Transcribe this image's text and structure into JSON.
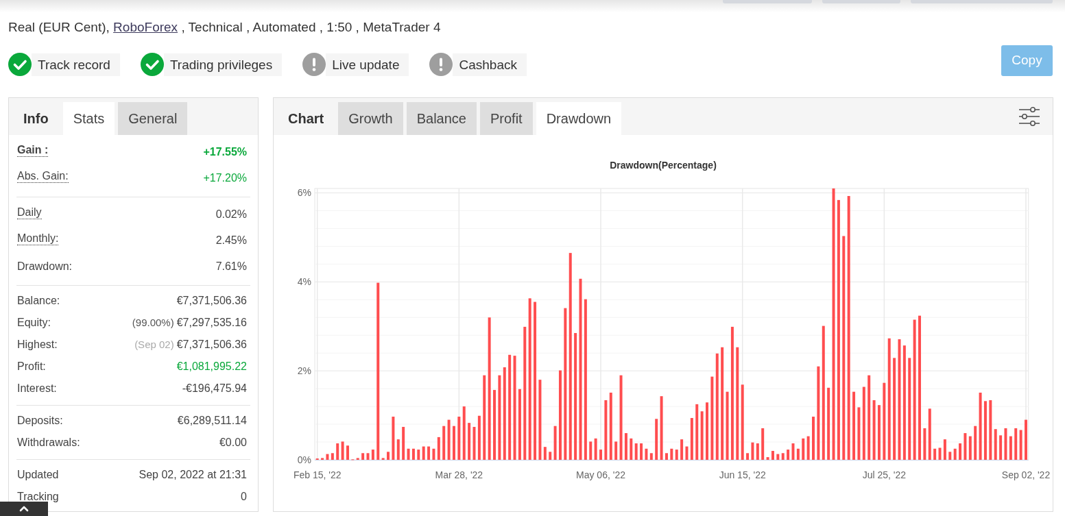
{
  "summary": [
    {
      "kind": "text",
      "text": "Real (EUR Cent),"
    },
    {
      "kind": "link",
      "text": "RoboForex"
    },
    {
      "kind": "text",
      "text": ", Technical , Automated , 1:50 , MetaTrader 4"
    }
  ],
  "badges": [
    {
      "label": "Track record",
      "verified": true
    },
    {
      "label": "Trading privileges",
      "verified": true
    },
    {
      "label": "Live update",
      "verified": false
    },
    {
      "label": "Cashback",
      "verified": false
    }
  ],
  "copy_button": {
    "label": "Copy"
  },
  "stats_panel": {
    "title": "Info",
    "tabs": [
      {
        "label": "Stats",
        "selected": true
      },
      {
        "label": "General",
        "selected": false
      }
    ],
    "groups": [
      {
        "rows": [
          {
            "label": "Gain :",
            "value": "+17.55%",
            "bold": true,
            "hint": true,
            "positive": true
          },
          {
            "label": "Abs. Gain:",
            "value": "+17.20%",
            "bold": false,
            "hint": true,
            "positive": true
          }
        ]
      },
      {
        "rows": [
          {
            "label": "Daily",
            "value": "0.02%",
            "bold": false,
            "hint": true,
            "positive": false
          },
          {
            "label": "Monthly:",
            "value": "2.45%",
            "bold": false,
            "hint": true,
            "positive": false
          },
          {
            "label": "Drawdown:",
            "value": "7.61%",
            "bold": false,
            "hint": false,
            "positive": false
          }
        ]
      },
      {
        "rows": [
          {
            "label": "Balance:",
            "value": "€7,371,506.36",
            "bold": false,
            "hint": false,
            "positive": false
          },
          {
            "label": "Equity:",
            "note": "(99.00%)",
            "note_muted": false,
            "value": "€7,297,535.16",
            "bold": false,
            "hint": false,
            "positive": false
          },
          {
            "label": "Highest:",
            "note": "(Sep 02)",
            "note_muted": true,
            "value": "€7,371,506.36",
            "bold": false,
            "hint": false,
            "positive": false
          },
          {
            "label": "Profit:",
            "value": "€1,081,995.22",
            "bold": false,
            "hint": false,
            "positive": true
          },
          {
            "label": "Interest:",
            "value": "-€196,475.94",
            "bold": false,
            "hint": false,
            "positive": false
          }
        ]
      },
      {
        "rows": [
          {
            "label": "Deposits:",
            "value": "€6,289,511.14",
            "bold": false,
            "hint": false,
            "positive": false
          },
          {
            "label": "Withdrawals:",
            "value": "€0.00",
            "bold": false,
            "hint": false,
            "positive": false
          }
        ]
      },
      {
        "rows": [
          {
            "label": "Updated",
            "value": "Sep 02, 2022 at 21:31",
            "bold": false,
            "hint": false,
            "positive": false
          },
          {
            "label": "Tracking",
            "value": "0",
            "bold": false,
            "hint": false,
            "positive": false
          }
        ]
      }
    ]
  },
  "chart_panel": {
    "title": "Chart",
    "tabs": [
      {
        "label": "Growth",
        "selected": false
      },
      {
        "label": "Balance",
        "selected": false
      },
      {
        "label": "Profit",
        "selected": false
      },
      {
        "label": "Drawdown",
        "selected": true
      }
    ],
    "chart_data": {
      "type": "bar",
      "title": "Drawdown(Percentage)",
      "grid": true,
      "ylim": [
        0,
        6.1
      ],
      "yticks": [
        {
          "value": 0,
          "label": "0%"
        },
        {
          "value": 2,
          "label": "2%"
        },
        {
          "value": 4,
          "label": "4%"
        },
        {
          "value": 6,
          "label": "6%"
        }
      ],
      "categories": [
        "Feb 15, '22",
        null,
        null,
        null,
        null,
        null,
        null,
        null,
        null,
        null,
        null,
        null,
        null,
        null,
        null,
        null,
        null,
        null,
        null,
        null,
        null,
        null,
        null,
        null,
        null,
        null,
        null,
        null,
        "Mar 28, '22",
        null,
        null,
        null,
        null,
        null,
        null,
        null,
        null,
        null,
        null,
        null,
        null,
        null,
        null,
        null,
        null,
        null,
        null,
        null,
        null,
        null,
        null,
        null,
        null,
        null,
        null,
        null,
        "May 06, '22",
        null,
        null,
        null,
        null,
        null,
        null,
        null,
        null,
        null,
        null,
        null,
        null,
        null,
        null,
        null,
        null,
        null,
        null,
        null,
        null,
        null,
        null,
        null,
        null,
        null,
        null,
        null,
        "Jun 15, '22",
        null,
        null,
        null,
        null,
        null,
        null,
        null,
        null,
        null,
        null,
        null,
        null,
        null,
        null,
        null,
        null,
        null,
        null,
        null,
        null,
        null,
        null,
        null,
        null,
        null,
        null,
        null,
        "Jul 25, '22",
        null,
        null,
        null,
        null,
        null,
        null,
        null,
        null,
        null,
        null,
        null,
        null,
        null,
        null,
        null,
        null,
        null,
        null,
        null,
        null,
        null,
        null,
        null,
        null,
        null,
        null,
        null,
        "Sep 02, '22"
      ],
      "values": [
        0.03,
        0.04,
        0.13,
        0.15,
        0.37,
        0.41,
        0.32,
        0.01,
        0.04,
        0.15,
        0.15,
        0.23,
        3.98,
        0.04,
        0.18,
        0.97,
        0.46,
        0.74,
        0.25,
        0.25,
        0.23,
        0.3,
        0.3,
        0.25,
        0.51,
        0.76,
        0.9,
        0.76,
        0.97,
        1.2,
        0.83,
        0.74,
        0.99,
        1.9,
        3.2,
        1.57,
        1.9,
        2.08,
        2.36,
        2.34,
        1.59,
        2.99,
        3.63,
        3.55,
        1.8,
        0.29,
        0.18,
        0.76,
        2.01,
        3.41,
        4.65,
        2.85,
        4.07,
        3.61,
        0.41,
        0.48,
        0.23,
        1.34,
        1.51,
        0.41,
        1.9,
        0.6,
        0.48,
        0.37,
        0.37,
        0.25,
        0.15,
        0.92,
        1.43,
        0.15,
        0.25,
        0.23,
        0.46,
        0.3,
        0.94,
        1.25,
        1.09,
        1.29,
        1.87,
        2.39,
        2.53,
        1.53,
        2.99,
        2.53,
        1.69,
        0.15,
        0.39,
        0.37,
        0.71,
        0.06,
        0.2,
        0.13,
        0.15,
        0.23,
        0.37,
        0.25,
        0.48,
        0.53,
        0.97,
        2.1,
        3.01,
        1.62,
        6.1,
        5.84,
        5.03,
        5.93,
        1.53,
        1.18,
        1.64,
        1.9,
        1.34,
        1.23,
        1.73,
        2.73,
        2.29,
        2.71,
        2.57,
        2.29,
        3.15,
        3.24,
        0.71,
        1.15,
        0.25,
        0.27,
        0.46,
        0.18,
        0.25,
        0.37,
        0.6,
        0.53,
        0.76,
        1.51,
        1.32,
        1.34,
        0.69,
        0.55,
        0.71,
        0.53,
        0.71,
        0.67,
        0.9
      ]
    }
  }
}
